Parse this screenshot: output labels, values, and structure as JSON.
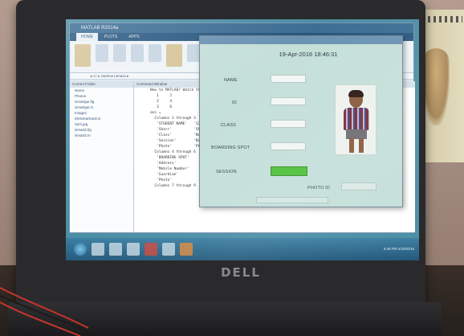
{
  "scene": {
    "laptop_brand": "DELL"
  },
  "matlab": {
    "window_title": "MATLAB R2014a",
    "tabs": [
      "HOME",
      "PLOTS",
      "APPS"
    ],
    "path_bar": "▸ C: ▸ Users ▸ Lenovo ▸",
    "current_folder_header": "Current Folder",
    "command_window_header": "Command Window",
    "files": [
      "Name",
      "Photos",
      "ismartgui.fig",
      "ismartgui.m",
      "Images",
      "MSSmartcard.m",
      "Sym.jpg",
      "ismart2.fig",
      "ismart2.m"
    ],
    "cmd_lines": [
      "New to MATLAB? Watch this Video, see",
      "   1     2",
      "   2     4",
      "   3     6",
      "",
      "ans =",
      "",
      "  Columns 1 through 3",
      "",
      "   'STUDENT NAME'   '123'",
      "   'Sharr'          'Sharr'",
      "   'Class'          'Name'",
      "   'Session'        'Batch'",
      "   'Photo'          'Photo'",
      "",
      "  Columns 4 through 6",
      "",
      "   'BOARDING SPOT'",
      "   'Address'",
      "   'Mobile Number'",
      "   'Guardian'",
      "   'Photo'",
      "",
      "  Columns 7 through 9"
    ]
  },
  "gui": {
    "datetime": "19-Apr-2016 18:46:31",
    "labels": {
      "name": "NAME",
      "id": "ID",
      "class": "CLASS",
      "boarding": "BOARDING SPOT",
      "session": "SESSION",
      "photo_id": "PHOTO ID"
    },
    "session_indicator_color": "#4fc13a"
  },
  "taskbar": {
    "clock": "6:46 PM\n4/19/2016"
  },
  "colors": {
    "screen_bg": "#4a8ea6",
    "gui_bg": "#c5dfd9"
  }
}
